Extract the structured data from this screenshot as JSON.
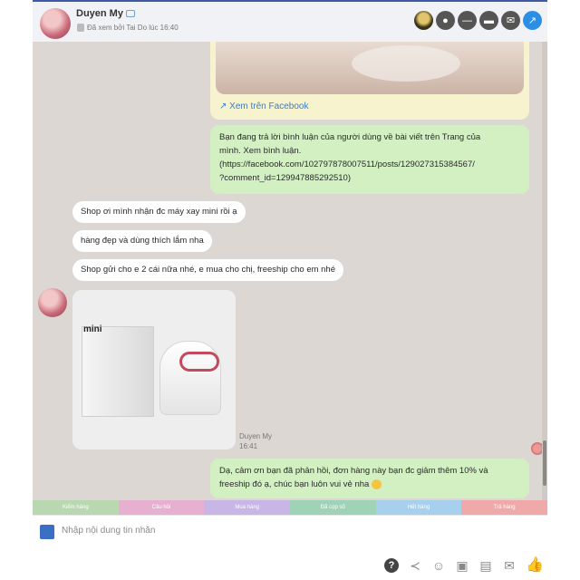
{
  "header": {
    "name": "Duyen My",
    "seen_text": "Đã xem bởi Tai Do lúc 16:40"
  },
  "messages": {
    "fb_link": "Xem trên Facebook",
    "reply_notice": [
      "Bạn đang trả lời bình luận của người dùng về bài viết trên Trang của",
      "mình. Xem bình luận.",
      "(https://facebook.com/102797878007511/posts/129027315384567/",
      "?comment_id=129947885292510)"
    ],
    "incoming": [
      "Shop ơi mình nhận đc máy xay mini rồi ạ",
      "hàng đẹp và dùng thích lắm nha",
      "Shop gửi cho e 2 cái nữa nhé, e mua cho chị, freeship cho em nhé"
    ],
    "image_box_label": "mini",
    "sender_name": "Duyen My",
    "sender_time": "16:41",
    "outgoing_last": [
      "Dạ, cảm ơn bạn đã phản hồi, đơn hàng này bạn đc giảm thêm 10% và",
      "freeship đó ạ, chúc bạn luôn vui vẻ nha"
    ]
  },
  "quick_tags": [
    {
      "label": "Kiểm hàng",
      "color": "#b9d7b0"
    },
    {
      "label": "Câu hỏi",
      "color": "#e8b0d0"
    },
    {
      "label": "Mua hàng",
      "color": "#c7b6e6"
    },
    {
      "label": "Đã cọp số",
      "color": "#9fd3b7"
    },
    {
      "label": "Hết hàng",
      "color": "#a7cfee"
    },
    {
      "label": "Trả hàng",
      "color": "#f0a9a9"
    }
  ],
  "composer": {
    "placeholder": "Nhập nội dung tin nhắn"
  },
  "colors": {
    "accent": "#2b7be0",
    "incoming_bubble": "#ffffff",
    "outgoing_bubble": "#d3f0c3",
    "chat_bg": "#dcd7d2"
  }
}
